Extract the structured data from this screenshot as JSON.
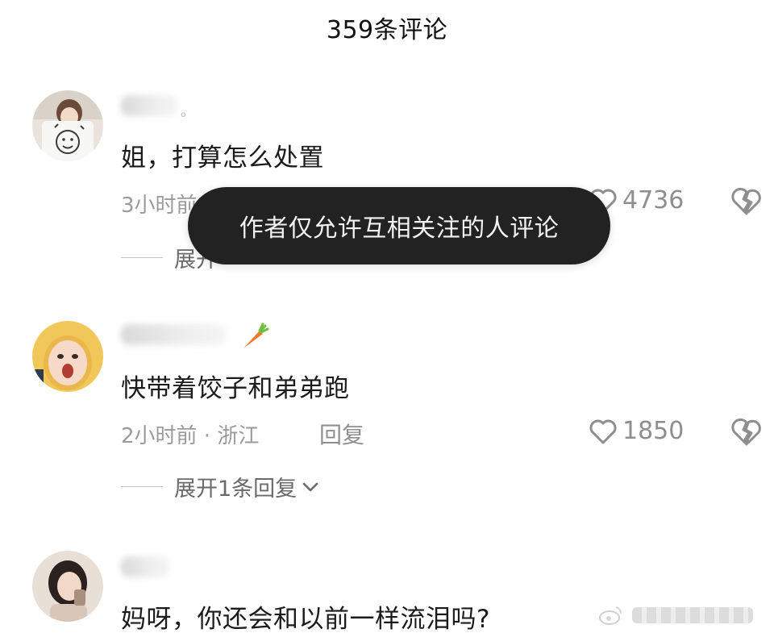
{
  "header": {
    "title": "359条评论"
  },
  "toast": {
    "message": "作者仅允许互相关注的人评论"
  },
  "comments": [
    {
      "username_tail": "。",
      "text": "姐，打算怎么处置",
      "time_location": "3小时前",
      "reply_label": "",
      "likes": "4736",
      "expand_label": "展开"
    },
    {
      "username_tail": "",
      "text": "快带着饺子和弟弟跑",
      "time_location": "2小时前 · 浙江",
      "reply_label": "回复",
      "likes": "1850",
      "expand_label": "展开1条回复"
    },
    {
      "username_tail": "",
      "text": "妈呀，你还会和以前一样流泪吗?",
      "time_location": "",
      "reply_label": "",
      "likes": "",
      "expand_label": ""
    }
  ],
  "icons": {
    "like": "heart-outline-icon",
    "dislike": "broken-heart-icon",
    "expand": "chevron-down-icon",
    "username_badge": "carrot-icon",
    "watermark": "weibo-logo-icon"
  },
  "colors": {
    "toast_background": "#222222",
    "meta_text": "#9b9b9b",
    "body_text": "#1b1b1b"
  }
}
